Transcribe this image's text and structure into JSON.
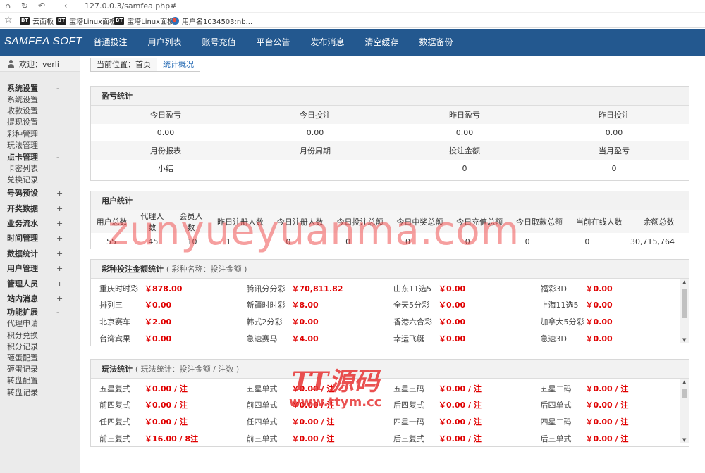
{
  "browser": {
    "url": "127.0.0.3/samfea.php#",
    "bookmarks": [
      {
        "badge": "BT",
        "label": "云面板"
      },
      {
        "badge": "BT",
        "label": "宝塔Linux面板"
      },
      {
        "badge": "BT",
        "label": "宝塔Linux面板"
      },
      {
        "badge": "",
        "label": "用户名1034503:nb..."
      }
    ]
  },
  "brand": "SAMFEA SOFT",
  "menu": [
    "普通投注",
    "用户列表",
    "账号充值",
    "平台公告",
    "发布消息",
    "清空缓存",
    "数据备份"
  ],
  "sidebar": {
    "welcome": "欢迎：verli",
    "groups": [
      {
        "label": "系统设置",
        "toggle": "-",
        "items": [
          "系统设置",
          "收款设置",
          "提现设置",
          "彩种管理",
          "玩法管理"
        ]
      },
      {
        "label": "点卡管理",
        "toggle": "-",
        "items": [
          "卡密列表",
          "兑换记录"
        ]
      },
      {
        "label": "号码预设",
        "toggle": "+",
        "items": []
      },
      {
        "label": "开奖数据",
        "toggle": "+",
        "items": []
      },
      {
        "label": "业务流水",
        "toggle": "+",
        "items": []
      },
      {
        "label": "时间管理",
        "toggle": "+",
        "items": []
      },
      {
        "label": "数据统计",
        "toggle": "+",
        "items": []
      },
      {
        "label": "用户管理",
        "toggle": "+",
        "items": []
      },
      {
        "label": "管理人员",
        "toggle": "+",
        "items": []
      },
      {
        "label": "站内消息",
        "toggle": "+",
        "items": []
      },
      {
        "label": "功能扩展",
        "toggle": "-",
        "items": [
          "代理申请",
          "积分兑换",
          "积分记录",
          "砸蛋配置",
          "砸蛋记录",
          "转盘配置",
          "转盘记录"
        ]
      }
    ]
  },
  "breadcrumb": {
    "location": "当前位置：首页",
    "tab": "统计概况"
  },
  "profit": {
    "title": "盈亏统计",
    "row1_headers": [
      "今日盈亏",
      "今日投注",
      "昨日盈亏",
      "昨日投注"
    ],
    "row1_values": [
      "0.00",
      "0.00",
      "0.00",
      "0.00"
    ],
    "row2_headers": [
      "月份报表",
      "月份周期",
      "投注金额",
      "当月盈亏"
    ],
    "row2_values": [
      "小结",
      "",
      "0",
      "0"
    ]
  },
  "users": {
    "title": "用户统计",
    "headers": [
      "用户总数",
      "代理人数",
      "会员人数",
      "昨日注册人数",
      "今日注册人数",
      "今日投注总额",
      "今日中奖总额",
      "今日充值总额",
      "今日取款总额",
      "当前在线人数",
      "余额总数"
    ],
    "values": [
      "55",
      "45",
      "10",
      "1",
      "0",
      "0",
      "0",
      "0",
      "0",
      "0",
      "30,715,764"
    ]
  },
  "lottery": {
    "title": "彩种投注金额统计",
    "hint": "( 彩种名称：投注金额 )",
    "rows": [
      [
        {
          "name": "重庆时时彩",
          "value": "￥878.00"
        },
        {
          "name": "腾讯分分彩",
          "value": "￥70,811.82"
        },
        {
          "name": "山东11选5",
          "value": "￥0.00"
        },
        {
          "name": "福彩3D",
          "value": "￥0.00"
        }
      ],
      [
        {
          "name": "排列三",
          "value": "￥0.00"
        },
        {
          "name": "新疆时时彩",
          "value": "￥8.00"
        },
        {
          "name": "全天5分彩",
          "value": "￥0.00"
        },
        {
          "name": "上海11选5",
          "value": "￥0.00"
        }
      ],
      [
        {
          "name": "北京赛车",
          "value": "￥2.00"
        },
        {
          "name": "韩式2分彩",
          "value": "￥0.00"
        },
        {
          "name": "香港六合彩",
          "value": "￥0.00"
        },
        {
          "name": "加拿大5分彩",
          "value": "￥0.00"
        }
      ],
      [
        {
          "name": "台湾宾果",
          "value": "￥0.00"
        },
        {
          "name": "急速赛马",
          "value": "￥4.00"
        },
        {
          "name": "幸运飞艇",
          "value": "￥0.00"
        },
        {
          "name": "急速3D",
          "value": "￥0.00"
        }
      ]
    ]
  },
  "plays": {
    "title": "玩法统计",
    "hint": "( 玩法统计：投注金额 / 注数 )",
    "rows": [
      [
        {
          "name": "五星复式",
          "value": "￥0.00 / 注"
        },
        {
          "name": "五星单式",
          "value": "￥0.00 / 注"
        },
        {
          "name": "五星三码",
          "value": "￥0.00 / 注"
        },
        {
          "name": "五星二码",
          "value": "￥0.00 / 注"
        }
      ],
      [
        {
          "name": "前四复式",
          "value": "￥0.00 / 注"
        },
        {
          "name": "前四单式",
          "value": "￥0.00 / 注"
        },
        {
          "name": "后四复式",
          "value": "￥0.00 / 注"
        },
        {
          "name": "后四单式",
          "value": "￥0.00 / 注"
        }
      ],
      [
        {
          "name": "任四复式",
          "value": "￥0.00 / 注"
        },
        {
          "name": "任四单式",
          "value": "￥0.00 / 注"
        },
        {
          "name": "四星一码",
          "value": "￥0.00 / 注"
        },
        {
          "name": "四星二码",
          "value": "￥0.00 / 注"
        }
      ],
      [
        {
          "name": "前三复式",
          "value": "￥16.00 / 8注"
        },
        {
          "name": "前三单式",
          "value": "￥0.00 / 注"
        },
        {
          "name": "后三复式",
          "value": "￥0.00 / 注"
        },
        {
          "name": "后三单式",
          "value": "￥0.00 / 注"
        }
      ]
    ]
  },
  "watermarks": {
    "main": "zunyueyuanma.com",
    "logo_text": "TT源码",
    "logo_url": "www.ttym.cc"
  },
  "colors": {
    "nav_bg": "#23588f",
    "amount_red": "#e00000",
    "link_blue": "#2c6fb7"
  }
}
